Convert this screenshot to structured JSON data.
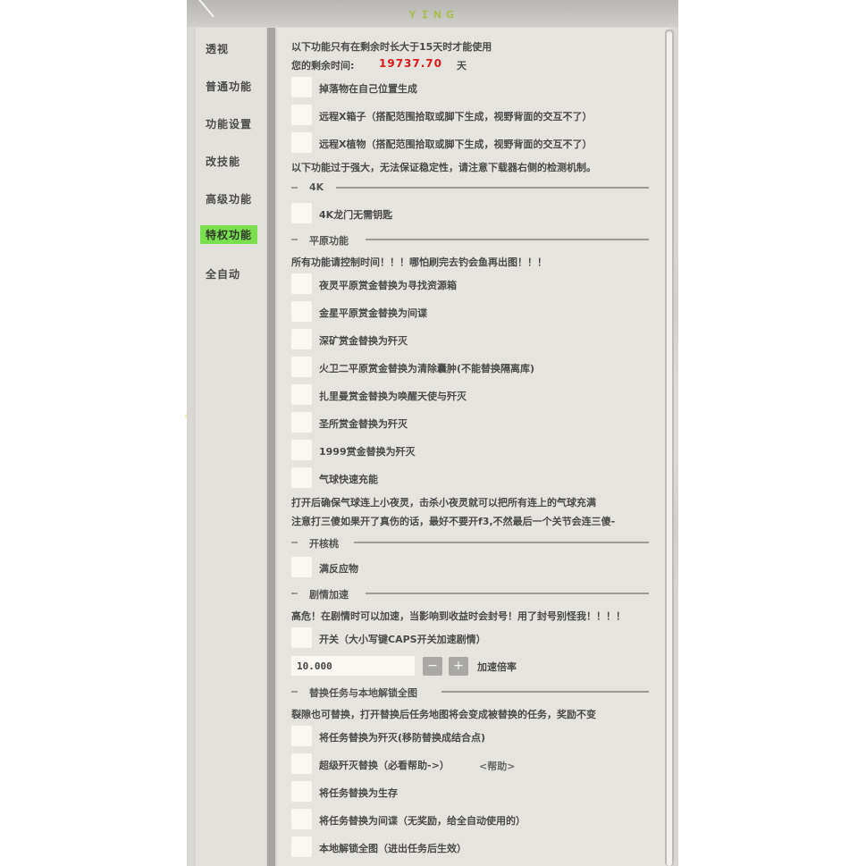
{
  "title": "ＹＩＮＧ",
  "sidebar": {
    "items": [
      {
        "label": "透视",
        "active": false
      },
      {
        "label": "普通功能",
        "active": false
      },
      {
        "label": "功能设置",
        "active": false
      },
      {
        "label": "改技能",
        "active": false
      },
      {
        "label": "高级功能",
        "active": false
      },
      {
        "label": "特权功能",
        "active": true
      },
      {
        "label": "全自动",
        "active": false
      }
    ]
  },
  "main": {
    "notice_duration": "以下功能只有在剩余时长大于15天时才能使用",
    "remaining_label": "您的剩余时间:",
    "remaining_value": "19737.70",
    "remaining_unit": "天",
    "opt_drop_self": "掉落物在自己位置生成",
    "opt_remote_box": "远程X箱子（搭配范围拾取或脚下生成，视野背面的交互不了）",
    "opt_remote_plant": "远程X植物（搭配范围拾取或脚下生成，视野背面的交互不了）",
    "warning_powerful": "以下功能过于强大，无法保证稳定性，请注意下载器右侧的检测机制。",
    "section_4k": "4K",
    "opt_4k_key": "4K龙门无需钥匙",
    "section_plains": "平原功能",
    "plains_notice": "所有功能请控制时间！！！哪怕刷完去钓会鱼再出图！！！",
    "opt_plains_1": "夜灵平原赏金替换为寻找资源箱",
    "opt_plains_2": "金星平原赏金替换为间谍",
    "opt_plains_3": "深矿赏金替换为歼灭",
    "opt_plains_4": "火卫二平原赏金替换为清除囊肿(不能替换隔离库)",
    "opt_plains_5": "扎里曼赏金替换为唤醒天使与歼灭",
    "opt_plains_6": "圣所赏金替换为歼灭",
    "opt_plains_7": "1999赏金替换为歼灭",
    "opt_plains_8": "气球快速充能",
    "balloon_note_1": "打开后确保气球连上小夜灵，击杀小夜灵就可以把所有连上的气球充满",
    "balloon_note_2": "注意打三傻如果开了真伤的话，最好不要开f3,不然最后一个关节会连三傻-",
    "section_nuke": "开核桃",
    "opt_full_reactant": "满反应物",
    "section_story": "剧情加速",
    "story_warning": "高危！在剧情时可以加速，当影响到收益时会封号！用了封号别怪我！！！！",
    "opt_story_toggle": "开关（大小写键CAPS开关加速剧情）",
    "speed_value": "10.000",
    "minus_label": "−",
    "plus_label": "+",
    "speed_label": "加速倍率",
    "section_mission": "替换任务与本地解锁全图",
    "mission_note": "裂隙也可替换，打开替换后任务地图将会变成被替换的任务，奖励不变",
    "opt_mission_1": "将任务替换为歼灭(移防替换成结合点)",
    "opt_mission_2": "超级歼灭替换（必看帮助->）",
    "help_label": "<帮助>",
    "opt_mission_3": "将任务替换为生存",
    "opt_mission_4": "将任务替换为间谍（无奖励，给全自动使用的）",
    "opt_mission_5": "本地解锁全图（进出任务后生效）"
  },
  "colors": {
    "accent_active": "#79df4f",
    "remaining_value": "#e01818",
    "title": "#a6bf3a"
  }
}
